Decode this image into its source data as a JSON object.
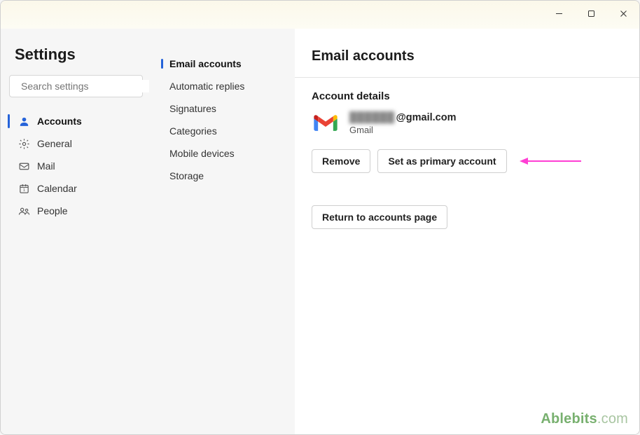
{
  "titlebar": {
    "minimize": "Minimize",
    "maximize": "Maximize",
    "close": "Close"
  },
  "sidebar": {
    "title": "Settings",
    "search_placeholder": "Search settings",
    "items": [
      {
        "label": "Accounts",
        "active": true
      },
      {
        "label": "General",
        "active": false
      },
      {
        "label": "Mail",
        "active": false
      },
      {
        "label": "Calendar",
        "active": false
      },
      {
        "label": "People",
        "active": false
      }
    ]
  },
  "subnav": {
    "items": [
      {
        "label": "Email accounts",
        "active": true
      },
      {
        "label": "Automatic replies",
        "active": false
      },
      {
        "label": "Signatures",
        "active": false
      },
      {
        "label": "Categories",
        "active": false
      },
      {
        "label": "Mobile devices",
        "active": false
      },
      {
        "label": "Storage",
        "active": false
      }
    ]
  },
  "main": {
    "heading": "Email accounts",
    "section_title": "Account details",
    "account": {
      "email_obscured": "██████",
      "email_suffix": "@gmail.com",
      "provider": "Gmail"
    },
    "buttons": {
      "remove": "Remove",
      "set_primary": "Set as primary account",
      "return": "Return to accounts page"
    }
  },
  "watermark": {
    "brand": "Ablebits",
    "domain": ".com"
  }
}
